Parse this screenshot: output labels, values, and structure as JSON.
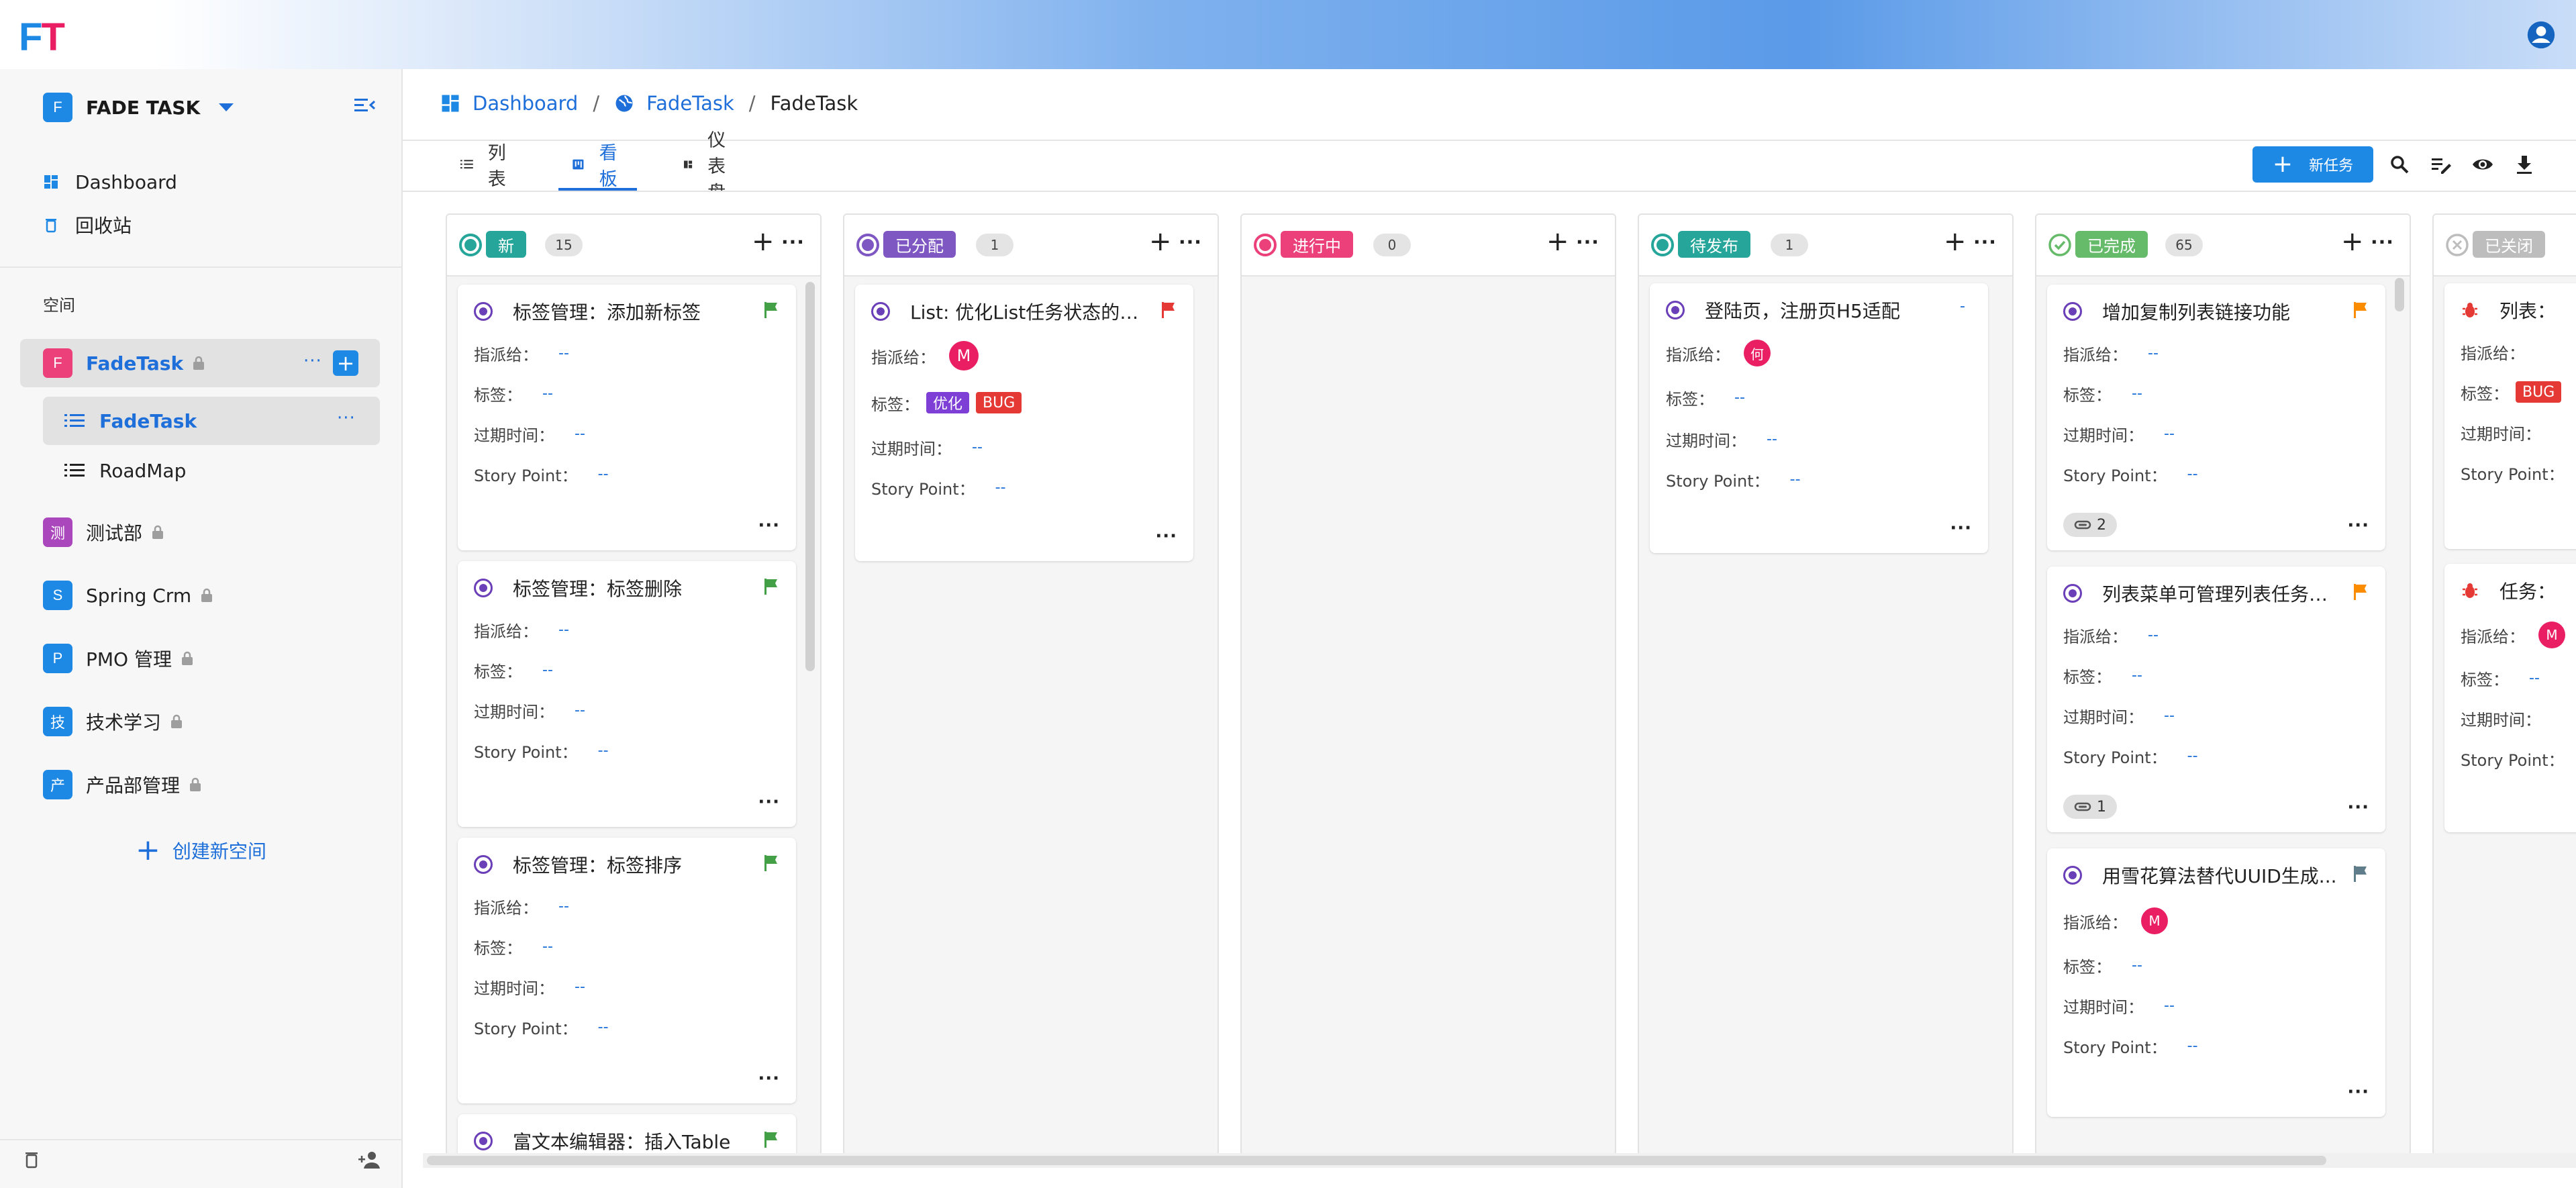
{
  "app": {
    "logo_f": "F",
    "logo_t": "T"
  },
  "sidebar": {
    "workspace": {
      "initial": "F",
      "name": "FADE TASK"
    },
    "nav": [
      {
        "label": "Dashboard"
      },
      {
        "label": "回收站"
      }
    ],
    "section_label": "空间",
    "spaces": [
      {
        "initial": "F",
        "label": "FadeTask",
        "color": "#ec407a",
        "locked": true,
        "active": true,
        "children": [
          {
            "label": "FadeTask",
            "active": true
          },
          {
            "label": "RoadMap",
            "active": false
          }
        ]
      },
      {
        "initial": "测",
        "label": "测试部",
        "color": "#ab47bc",
        "locked": true
      },
      {
        "initial": "S",
        "label": "Spring Crm",
        "color": "#1e88e5",
        "locked": true
      },
      {
        "initial": "P",
        "label": "PMO 管理",
        "color": "#1e88e5",
        "locked": true
      },
      {
        "initial": "技",
        "label": "技术学习",
        "color": "#1e88e5",
        "locked": true
      },
      {
        "initial": "产",
        "label": "产品部管理",
        "color": "#1e88e5",
        "locked": true
      }
    ],
    "create_space": "创建新空间",
    "more_dots": "···",
    "plus": "+"
  },
  "breadcrumb": {
    "items": [
      "Dashboard",
      "FadeTask"
    ],
    "current": "FadeTask",
    "sep": "/"
  },
  "tabs": [
    {
      "label": "列表",
      "active": false
    },
    {
      "label": "看板",
      "active": true
    },
    {
      "label": "仪表盘",
      "active": false
    }
  ],
  "toolbar": {
    "new_task": "新任务",
    "plus": "+"
  },
  "common": {
    "plus": "+",
    "more": "···"
  },
  "fields": {
    "assignee": "指派给：",
    "tags": "标签：",
    "due": "过期时间：",
    "story_point": "Story Point：",
    "empty": "--"
  },
  "columns": [
    {
      "status": "新",
      "count": "15",
      "color": "#26a69a",
      "cards": [
        {
          "title": "标签管理：添加新标签",
          "flag": "#43a047"
        },
        {
          "title": "标签管理：标签删除",
          "flag": "#43a047"
        },
        {
          "title": "标签管理：标签排序",
          "flag": "#43a047"
        },
        {
          "title": "富文本编辑器：插入Table",
          "flag": "#43a047"
        }
      ]
    },
    {
      "status": "已分配",
      "count": "1",
      "color": "#7e57c2",
      "cards": [
        {
          "title": "List: 优化List任务状态的编...",
          "flag": "#e53935",
          "assignee": "M",
          "tags": [
            "优化",
            "BUG"
          ]
        }
      ]
    },
    {
      "status": "进行中",
      "count": "0",
      "color": "#ec407a",
      "cards": []
    },
    {
      "status": "待发布",
      "count": "1",
      "color": "#26a69a",
      "cards": [
        {
          "title": "登陆页，注册页H5适配",
          "flag_text": "-",
          "assignee": "何"
        }
      ]
    },
    {
      "status": "已完成",
      "count": "65",
      "color": "#66bb6a",
      "cards": [
        {
          "title": "增加复制列表链接功能",
          "flag": "#fb8c00",
          "attachments": "2"
        },
        {
          "title": "列表菜单可管理列表任务状...",
          "flag": "#fb8c00",
          "attachments": "1"
        },
        {
          "title": "用雪花算法替代UUID生成...",
          "flag": "#607d8b",
          "assignee": "M"
        }
      ]
    },
    {
      "status": "已关闭",
      "color": "#bdbdbd",
      "cards": [
        {
          "title": "列表：",
          "tags": [
            "BUG"
          ]
        },
        {
          "title": "任务：",
          "assignee": "M"
        }
      ]
    }
  ]
}
